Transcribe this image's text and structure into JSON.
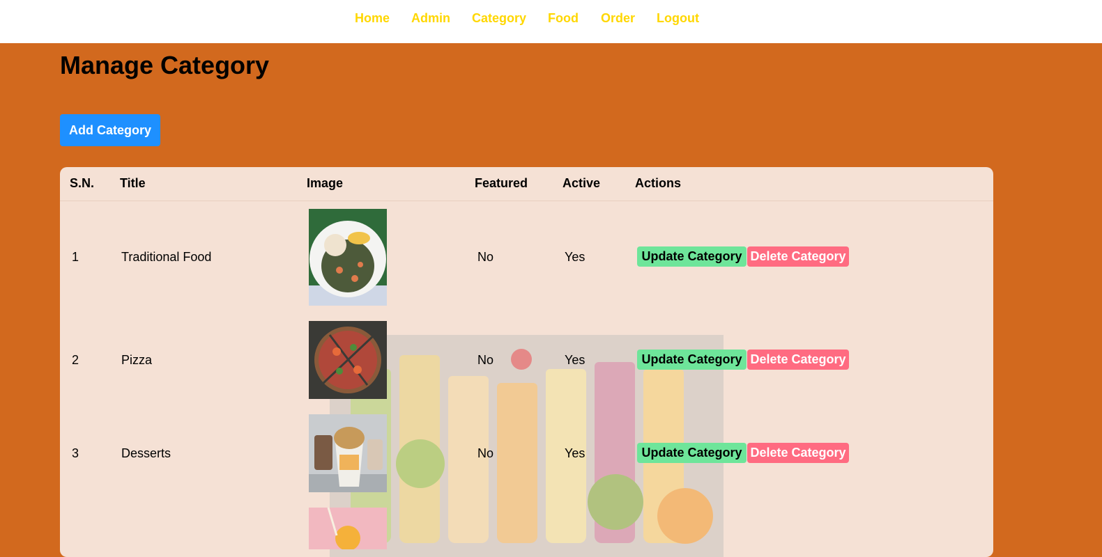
{
  "nav": {
    "links": [
      "Home",
      "Admin",
      "Category",
      "Food",
      "Order",
      "Logout"
    ]
  },
  "page": {
    "title": "Manage Category",
    "add_button": "Add Category"
  },
  "table": {
    "columns": [
      "S.N.",
      "Title",
      "Image",
      "Featured",
      "Active",
      "Actions"
    ],
    "rows": [
      {
        "sn": "1",
        "title": "Traditional Food",
        "featured": "No",
        "active": "Yes",
        "update_label": "Update Category",
        "delete_label": "Delete Category"
      },
      {
        "sn": "2",
        "title": "Pizza",
        "featured": "No",
        "active": "Yes",
        "update_label": "Update Category",
        "delete_label": "Delete Category"
      },
      {
        "sn": "3",
        "title": "Desserts",
        "featured": "No",
        "active": "Yes",
        "update_label": "Update Category",
        "delete_label": "Delete Category"
      }
    ]
  },
  "colors": {
    "page_background": "#d2691e",
    "nav_link": "#ffd700",
    "add_button": "#1e90ff",
    "update_button": "#6ee59a",
    "delete_button": "#ff6b81",
    "table_background": "#f5e1d5"
  }
}
